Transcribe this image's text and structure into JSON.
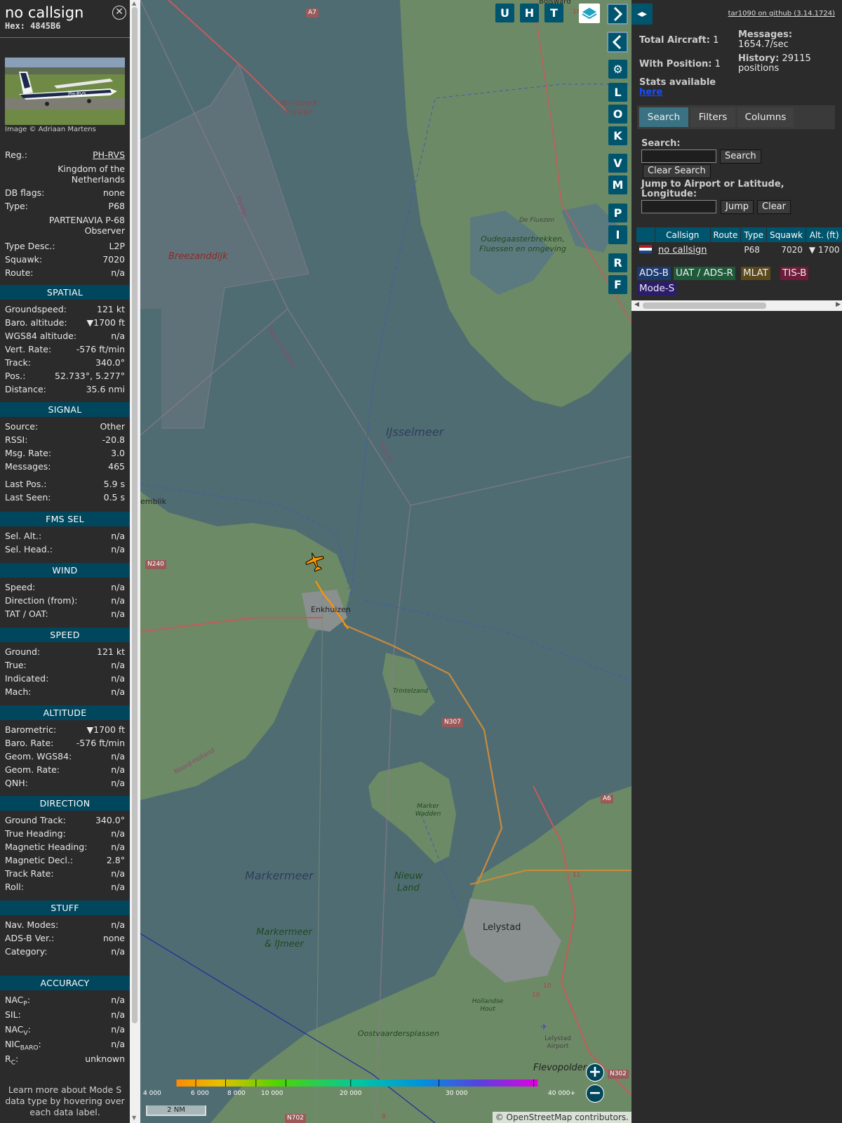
{
  "info": {
    "callsign": "no callsign",
    "hex": "Hex: 4845B6",
    "close_icon": "close-circle-icon",
    "photo_credit": "Image © Adriaan Martens",
    "photo_reg_text": "PH-RVS",
    "reg_label": "Reg.:",
    "reg_value": "PH-RVS",
    "country": "Kingdom of the Netherlands",
    "dbflags_label": "DB flags:",
    "dbflags_value": "none",
    "type_label": "Type:",
    "type_value": "P68",
    "type_full": "PARTENAVIA P-68 Observer",
    "typedesc_label": "Type Desc.:",
    "typedesc_value": "L2P",
    "squawk_label": "Squawk:",
    "squawk_value": "7020",
    "route_label": "Route:",
    "route_value": "n/a",
    "sections": {
      "spatial": "SPATIAL",
      "signal": "SIGNAL",
      "fms": "FMS SEL",
      "wind": "WIND",
      "speed": "SPEED",
      "altitude": "ALTITUDE",
      "direction": "DIRECTION",
      "stuff": "STUFF",
      "accuracy": "ACCURACY"
    },
    "spatial": [
      {
        "label": "Groundspeed:",
        "value": "121 kt"
      },
      {
        "label": "Baro. altitude:",
        "value": "▼1700 ft"
      },
      {
        "label": "WGS84 altitude:",
        "value": "n/a"
      },
      {
        "label": "Vert. Rate:",
        "value": "-576 ft/min"
      },
      {
        "label": "Track:",
        "value": "340.0°"
      },
      {
        "label": "Pos.:",
        "value": "52.733°, 5.277°"
      },
      {
        "label": "Distance:",
        "value": "35.6 nmi"
      }
    ],
    "signal": [
      {
        "label": "Source:",
        "value": "Other"
      },
      {
        "label": "RSSI:",
        "value": "-20.8"
      },
      {
        "label": "Msg. Rate:",
        "value": "3.0"
      },
      {
        "label": "Messages:",
        "value": "465"
      },
      {
        "label": "Last Pos.:",
        "value": "5.9 s"
      },
      {
        "label": "Last Seen:",
        "value": "0.5 s"
      }
    ],
    "fms": [
      {
        "label": "Sel. Alt.:",
        "value": "n/a"
      },
      {
        "label": "Sel. Head.:",
        "value": "n/a"
      }
    ],
    "wind": [
      {
        "label": "Speed:",
        "value": "n/a"
      },
      {
        "label": "Direction (from):",
        "value": "n/a"
      },
      {
        "label": "TAT / OAT:",
        "value": "n/a"
      }
    ],
    "speed": [
      {
        "label": "Ground:",
        "value": "121 kt"
      },
      {
        "label": "True:",
        "value": "n/a"
      },
      {
        "label": "Indicated:",
        "value": "n/a"
      },
      {
        "label": "Mach:",
        "value": "n/a"
      }
    ],
    "altitude": [
      {
        "label": "Barometric:",
        "value": "▼1700 ft"
      },
      {
        "label": "Baro. Rate:",
        "value": "-576 ft/min"
      },
      {
        "label": "Geom. WGS84:",
        "value": "n/a"
      },
      {
        "label": "Geom. Rate:",
        "value": "n/a"
      },
      {
        "label": "QNH:",
        "value": "n/a"
      }
    ],
    "direction": [
      {
        "label": "Ground Track:",
        "value": "340.0°"
      },
      {
        "label": "True Heading:",
        "value": "n/a"
      },
      {
        "label": "Magnetic Heading:",
        "value": "n/a"
      },
      {
        "label": "Magnetic Decl.:",
        "value": "2.8°"
      },
      {
        "label": "Track Rate:",
        "value": "n/a"
      },
      {
        "label": "Roll:",
        "value": "n/a"
      }
    ],
    "stuff": [
      {
        "label": "Nav. Modes:",
        "value": "n/a"
      },
      {
        "label": "ADS-B Ver.:",
        "value": "none"
      },
      {
        "label": "Category:",
        "value": "n/a"
      }
    ],
    "accuracy": [
      {
        "label": "NAC",
        "sub": "P",
        "value": "n/a"
      },
      {
        "label": "SIL:",
        "sub": "",
        "value": "n/a"
      },
      {
        "label": "NAC",
        "sub": "V",
        "value": "n/a"
      },
      {
        "label": "NIC",
        "sub": "BARO",
        "value": "n/a"
      },
      {
        "label": "R",
        "sub": "C",
        "value": "unknown"
      }
    ],
    "footer": "Learn more about Mode S data type by hovering over each data label."
  },
  "map": {
    "place_labels": {
      "windpark": "Windpark Fryslân",
      "breezanddijk": "Breezanddijk",
      "fryslan1": "Fryslân",
      "noordholland1": "Noord-Holland",
      "oudegaaster": "Oudegaasterbrekken, Fluessen en omgeving",
      "defluezen": "De Fluezen",
      "ijsselmeer": "IJsselmeer",
      "fryslan2": "Fryslân",
      "emblik": "emblik",
      "enkhuizen": "Enkhuizen",
      "trintelzand": "Trintelzand",
      "noordholland2": "Noord-Holland",
      "markerwadden": "Marker Wadden",
      "markermeer": "Markermeer",
      "nieuwland": "Nieuw Land",
      "markermeerij": "Markermeer & IJmeer",
      "lelystad": "Lelystad",
      "hollandsehout": "Hollandse Hout",
      "oostvaarders": "Oostvaardersplassen",
      "lelystadairport": "Lelystad Airport",
      "flevopolder": "Flevopolder",
      "bolsward": "Bolsward"
    },
    "road_labels": {
      "a7": "A7",
      "n240": "N240",
      "n307": "N307",
      "a6": "A6",
      "n302": "N302",
      "n702": "N702",
      "r18": "18",
      "r11": "11",
      "r10a": "10",
      "r10b": "10",
      "r8": "8"
    },
    "buttons": {
      "u": "U",
      "h": "H",
      "t": "T",
      "l": "L",
      "o": "O",
      "k": "K",
      "v": "V",
      "m": "M",
      "p": "P",
      "i": "I",
      "r": "R",
      "f": "F"
    },
    "layers_icon": "layers-icon",
    "settings_icon": "gear-icon",
    "altitude_ticks": [
      "4 000",
      "6 000",
      "8 000",
      "10 000",
      "20 000",
      "30 000",
      "40 000+"
    ],
    "scale_label": "2 NM",
    "attribution": "© OpenStreetMap contributors.",
    "zoom_in": "+",
    "zoom_out": "−",
    "aircraft_color": "#ff9500",
    "water_color": "#4f6c73",
    "land_color": "#6d8a66"
  },
  "right": {
    "github": "tar1090 on github (3.14.1724)",
    "total_aircraft_label": "Total Aircraft:",
    "total_aircraft_value": "1",
    "with_position_label": "With Position:",
    "with_position_value": "1",
    "messages_label": "Messages:",
    "messages_value": "1654.7/sec",
    "history_label": "History:",
    "history_value": "29115 positions",
    "stats_label": "Stats available",
    "stats_link": "here",
    "tabs": [
      "Search",
      "Filters",
      "Columns"
    ],
    "search_label": "Search:",
    "search_button": "Search",
    "clear_search_button": "Clear Search",
    "jump_label": "Jump to Airport or Latitude, Longitude:",
    "jump_button": "Jump",
    "clear_button": "Clear",
    "columns": [
      "Callsign",
      "Route",
      "Type",
      "Squawk",
      "Alt. (ft)"
    ],
    "row": {
      "flag": "flag-netherlands-icon",
      "callsign": "no callsign",
      "route": "",
      "type": "P68",
      "squawk": "7020",
      "alt": "▼ 1700"
    },
    "badges": [
      {
        "label": "ADS-B",
        "color": "#1c3a6e"
      },
      {
        "label": "UAT / ADS-R",
        "color": "#1f5a3a"
      },
      {
        "label": "MLAT",
        "color": "#5a4a1c"
      },
      {
        "label": "TIS-B",
        "color": "#6e1c3a"
      },
      {
        "label": "Mode-S",
        "color": "#2c1c6e"
      }
    ]
  }
}
